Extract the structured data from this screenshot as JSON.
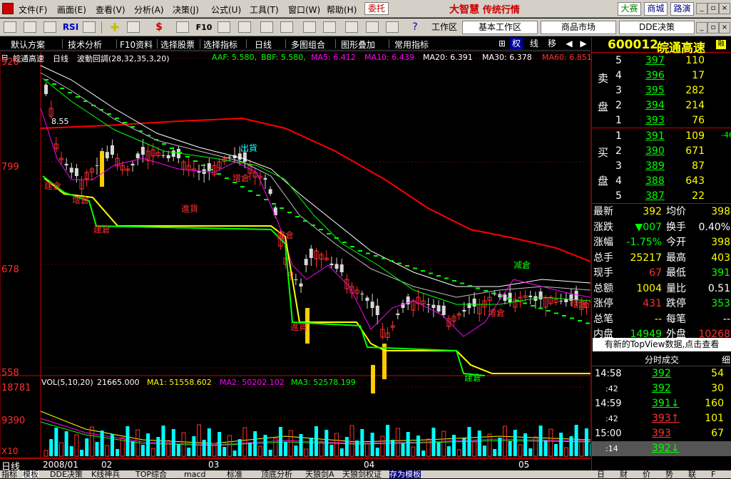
{
  "menu": {
    "items": [
      "文件(F)",
      "画面(E)",
      "查看(V)",
      "分析(A)",
      "决策(J)",
      "公式(U)",
      "工具(T)",
      "窗口(W)",
      "帮助(H)"
    ],
    "weituo": "委托",
    "brand": "大智慧",
    "brand_sub": "传统行情",
    "btn_dasai": "大赛",
    "btn_shangcheng": "商城",
    "btn_lubiao": "路演"
  },
  "toolbar": {
    "rsi": "RSI",
    "f10": "F10",
    "workspace_label": "工作区",
    "ws_tabs": [
      "基本工作区",
      "商品市场",
      "DDE决策"
    ]
  },
  "subbar": {
    "items": [
      "默认方案",
      "技术分析",
      "F10资料",
      "选择股票",
      "选择指标",
      "日线",
      "多图组合",
      "图形叠加",
      "常用指标"
    ],
    "controls": [
      "权",
      "线",
      "移"
    ]
  },
  "legend": {
    "stock": "皖通高速",
    "period": "日线",
    "indicator": "波動回調(28,32,35,3,20)",
    "aaf": "AAF: 5.580,",
    "bbf": "BBF: 5.580,",
    "ma5": "MA5: 6.412",
    "ma10": "MA10: 6.439",
    "ma20": "MA20: 6.391",
    "ma30": "MA30: 6.378",
    "ma60": "MA60: 6.851"
  },
  "price_axis": {
    "labels": [
      "920",
      "799",
      "678",
      "558"
    ]
  },
  "volume_axis": {
    "labels": [
      "18781",
      "9390",
      "X10"
    ]
  },
  "vol_legend": {
    "vol": "VOL(5,10,20)",
    "v1": "21665.000",
    "ma1": "MA1: 51558.602",
    "ma2": "MA2: 50202.102",
    "ma3": "MA3: 52578.199"
  },
  "date_axis": {
    "labels": [
      "日线",
      "2008/01",
      "02",
      "03",
      "04",
      "05"
    ]
  },
  "bottom_tabs": [
    "指标",
    "模板",
    "DDE决策",
    "K线神兵",
    "TOP综合",
    "macd",
    "标准",
    "顶底分析",
    "天狼剑A",
    "天狼剑权证",
    "存为模板"
  ],
  "annotations": {
    "price_mark": "8.55",
    "chu_huo": "出貨",
    "jin_huo": "進貨",
    "jian_chang": "建倉",
    "zeng_cang": "增倉",
    "jian_cang": "减倉"
  },
  "colors": {
    "up": "#ff3030",
    "down": "#e0e0e0",
    "ma5": "#ff00ff",
    "ma10": "#ffffff",
    "ma20": "#00ff00",
    "ma60": "#ff0000",
    "yellow": "#ffff00",
    "green_step": "#00ff00",
    "cyan_vol": "#00ffff"
  },
  "quote": {
    "code": "600012",
    "name": "皖通高速",
    "sell": [
      {
        "n": "5",
        "price": "397",
        "vol": "110"
      },
      {
        "n": "4",
        "price": "396",
        "vol": "17"
      },
      {
        "n": "3",
        "price": "395",
        "vol": "282"
      },
      {
        "n": "2",
        "price": "394",
        "vol": "214"
      },
      {
        "n": "1",
        "price": "393",
        "vol": "76"
      }
    ],
    "buy": [
      {
        "n": "1",
        "price": "391",
        "vol": "109"
      },
      {
        "n": "2",
        "price": "390",
        "vol": "671"
      },
      {
        "n": "3",
        "price": "389",
        "vol": "87"
      },
      {
        "n": "4",
        "price": "388",
        "vol": "643"
      },
      {
        "n": "5",
        "price": "387",
        "vol": "22"
      }
    ],
    "sell_label": [
      "卖",
      "盘"
    ],
    "buy_label": [
      "买",
      "盘"
    ],
    "buy_change": "-46",
    "stats": [
      {
        "k1": "最新",
        "v1": "392",
        "k2": "均价",
        "v2": "398"
      },
      {
        "k1": "涨跌",
        "v1": "▼007",
        "k2": "换手",
        "v2": "0.40%"
      },
      {
        "k1": "涨幅",
        "v1": "-1.75%",
        "k2": "今开",
        "v2": "398"
      },
      {
        "k1": "总手",
        "v1": "25217",
        "k2": "最高",
        "v2": "403"
      },
      {
        "k1": "现手",
        "v1": "67",
        "k2": "最低",
        "v2": "391"
      },
      {
        "k1": "总额",
        "v1": "1004",
        "k2": "量比",
        "v2": "0.51"
      },
      {
        "k1": "涨停",
        "v1": "431",
        "k2": "跌停",
        "v2": "353"
      },
      {
        "k1": "总笔",
        "v1": "--",
        "k2": "每笔",
        "v2": "--"
      },
      {
        "k1": "内盘",
        "v1": "14949",
        "k2": "外盘",
        "v2": "10268"
      }
    ],
    "topview": "有新的TopView数据,点击查看",
    "trades_title": "分时成交",
    "trades_hdr_r": "细",
    "trades": [
      {
        "t": "14:58",
        "p": "392",
        "v": "54"
      },
      {
        "t": ":42",
        "p": "392",
        "v": "30"
      },
      {
        "t": "14:59",
        "p": "391",
        "arr": "↓",
        "v": "160"
      },
      {
        "t": ":42",
        "p": "393",
        "arr": "↑",
        "v": "101"
      },
      {
        "t": "15:00",
        "p": "393",
        "v": "67"
      },
      {
        "t": ":14",
        "p": "392",
        "arr": "↓",
        "v": ""
      }
    ],
    "bottom_tabs": [
      "日",
      "财",
      "价",
      "势",
      "联",
      "F"
    ]
  }
}
